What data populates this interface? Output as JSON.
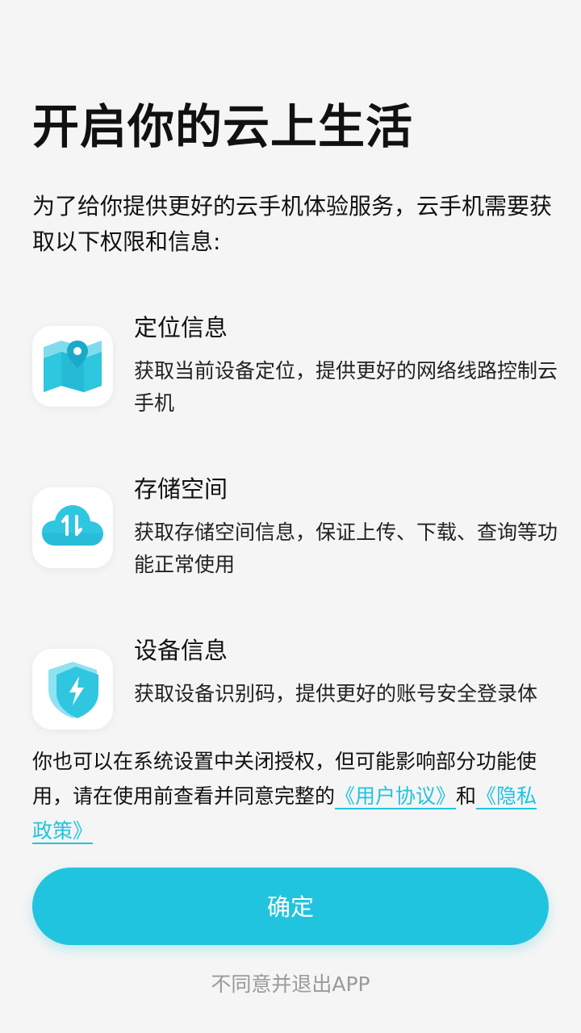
{
  "header": {
    "title": "开启你的云上生活",
    "intro": "为了给你提供更好的云手机体验服务，云手机需要获取以下权限和信息:"
  },
  "permissions": [
    {
      "icon": "map-pin-icon",
      "title": "定位信息",
      "description": "获取当前设备定位，提供更好的网络线路控制云手机"
    },
    {
      "icon": "cloud-transfer-icon",
      "title": "存储空间",
      "description": "获取存储空间信息，保证上传、下载、查询等功能正常使用"
    },
    {
      "icon": "shield-bolt-icon",
      "title": "设备信息",
      "description": "获取设备识别码，提供更好的账号安全登录体"
    }
  ],
  "notice": {
    "text_before": "你也可以在系统设置中关闭授权，但可能影响部分功能使用，请在使用前查看并同意完整的",
    "user_agreement_link": "《用户协议》",
    "conjunction": "和",
    "privacy_policy_link": "《隐私政策》"
  },
  "actions": {
    "confirm_label": "确定",
    "decline_label": "不同意并退出APP"
  },
  "colors": {
    "accent": "#21c4de",
    "background": "#f5f5f5",
    "muted_text": "#9a9a9a"
  }
}
